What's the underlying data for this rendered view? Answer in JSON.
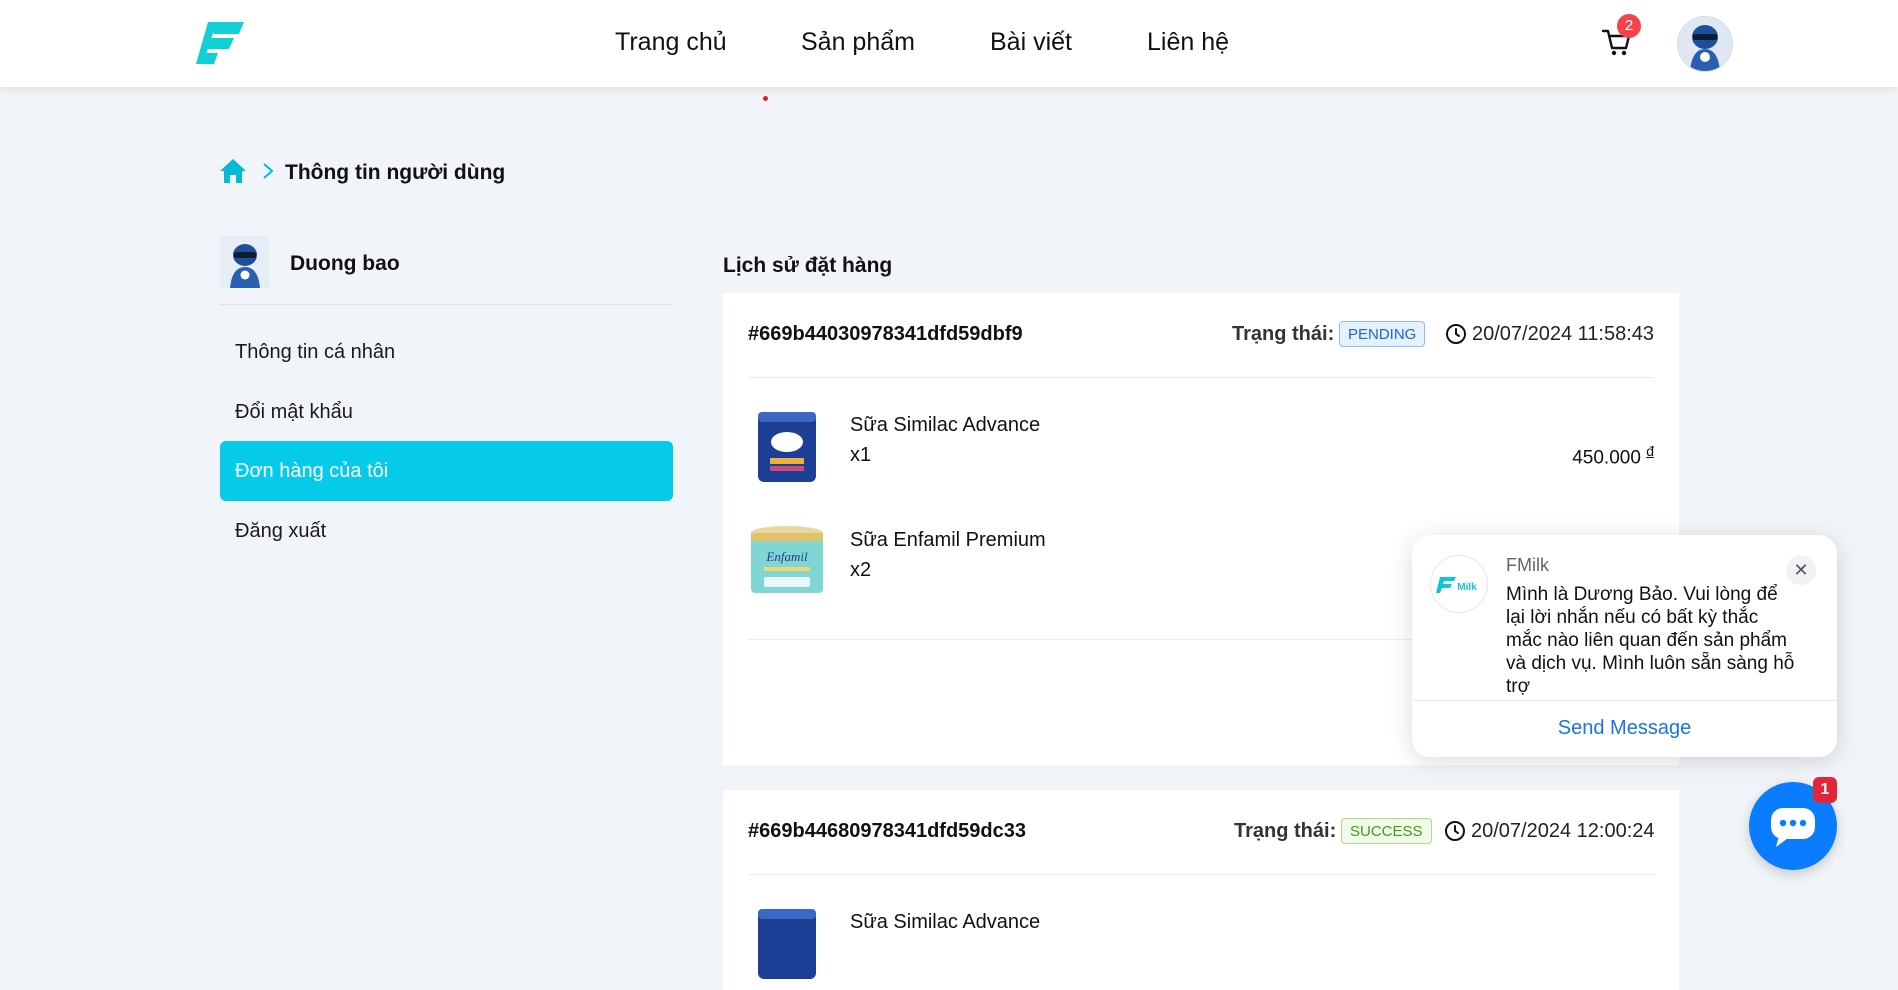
{
  "header": {
    "nav": [
      "Trang chủ",
      "Sản phẩm",
      "Bài viết",
      "Liên hệ"
    ],
    "cart_count": "2"
  },
  "breadcrumb": {
    "current": "Thông tin người dùng"
  },
  "sidebar": {
    "user_name": "Duong bao",
    "menu": [
      "Thông tin cá nhân",
      "Đổi mật khẩu",
      "Đơn hàng của tôi",
      "Đăng xuất"
    ],
    "active_item": "Đơn hàng của tôi"
  },
  "orders_section": {
    "title": "Lịch sử đặt hàng",
    "status_label": "Trạng thái:",
    "orders": [
      {
        "id": "#669b44030978341dfd59dbf9",
        "status": "PENDING",
        "time": "20/07/2024 11:58:43",
        "items": [
          {
            "name": "Sữa Similac Advance",
            "qty": "x1",
            "price": "450.000",
            "currency": "đ"
          },
          {
            "name": "Sữa Enfamil Premium",
            "qty": "x2"
          }
        ]
      },
      {
        "id": "#669b44680978341dfd59dc33",
        "status": "SUCCESS",
        "time": "20/07/2024 12:00:24",
        "items": [
          {
            "name": "Sữa Similac Advance"
          }
        ]
      }
    ]
  },
  "chat": {
    "name": "FMilk",
    "message": "Mình là Dương Bảo. Vui lòng để lại lời nhắn nếu có bất kỳ thắc mắc nào liên quan đến sản phẩm và dịch vụ. Mình luôn sẵn sàng hỗ trợ",
    "close_symbol": "✕",
    "send_label": "Send Message",
    "unread": "1"
  },
  "colors": {
    "accent": "#06cbe8",
    "link_blue": "#1a73e8",
    "messenger_blue": "#0a7cff",
    "badge_red": "#f5424c"
  }
}
